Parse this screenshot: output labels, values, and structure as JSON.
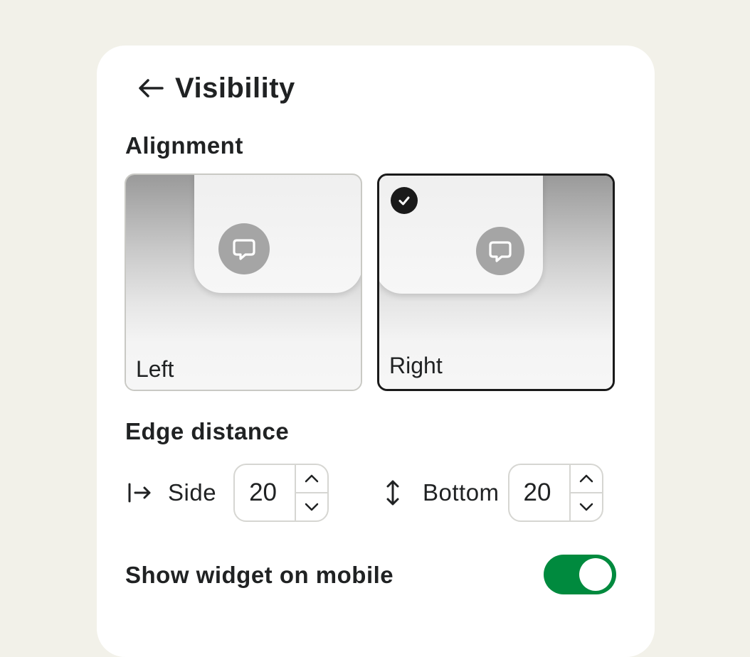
{
  "header": {
    "title": "Visibility",
    "back_icon": "arrow-left-icon"
  },
  "alignment": {
    "label": "Alignment",
    "options": [
      {
        "label": "Left",
        "selected": false
      },
      {
        "label": "Right",
        "selected": true
      }
    ]
  },
  "edge_distance": {
    "label": "Edge distance",
    "side": {
      "label": "Side",
      "value": "20",
      "icon": "arrow-to-side-icon"
    },
    "bottom": {
      "label": "Bottom",
      "value": "20",
      "icon": "vertical-arrows-icon"
    }
  },
  "mobile": {
    "label": "Show widget on mobile",
    "enabled": true
  },
  "colors": {
    "background": "#f2f1e9",
    "panel": "#ffffff",
    "toggle_on": "#008a3e",
    "selected_border": "#1a1a1a"
  }
}
